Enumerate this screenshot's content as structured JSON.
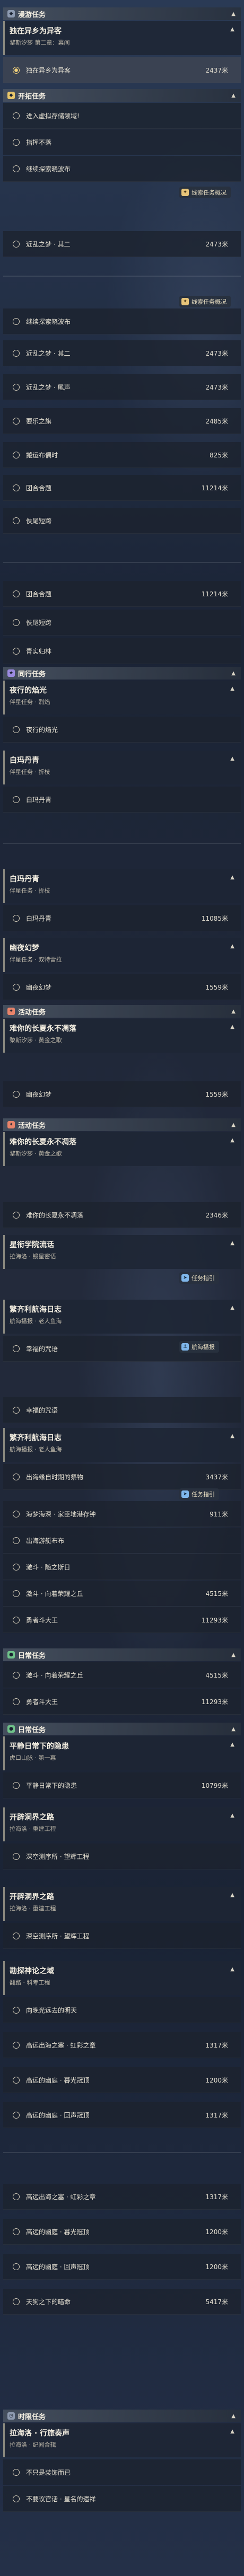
{
  "sections": {
    "exploration": {
      "label": "漫游任务"
    },
    "trailblaze": {
      "label": "开拓任务"
    },
    "companion": {
      "label": "同行任务"
    },
    "event": {
      "label": "活动任务"
    },
    "daily": {
      "label": "日常任务"
    },
    "time": {
      "label": "时限任务"
    }
  },
  "badges": {
    "trail": "线索任务概况",
    "guide": "任务指引",
    "flight": "航海播报"
  },
  "quests": {
    "q1": {
      "title": "独在异乡为异客",
      "sub": "黎斯汐莎 第二章：幕间"
    },
    "c1": {
      "title": "夜行的焰光",
      "sub": "伴星任务 · 烈焰"
    },
    "c2": {
      "title": "白玛丹青",
      "sub": "伴星任务 · 折枝"
    },
    "c3": {
      "title": "白玛丹青",
      "sub": "伴星任务 · 折枝"
    },
    "c4": {
      "title": "幽夜幻梦",
      "sub": "伴星任务 · 双特雷拉"
    },
    "e1": {
      "title": "难你的长夏永不凋落",
      "sub": "黎斯汐莎 · 黄金之歌"
    },
    "e2": {
      "title": "难你的长夏永不凋落",
      "sub": "黎斯汐莎 · 黄金之歌"
    },
    "e3": {
      "title": "星衔学院流话",
      "sub": "拉海洛 · 镜星密语"
    },
    "e4": {
      "title": "繁齐利航海日志",
      "sub": "航海播报 · 老人鱼海"
    },
    "e5": {
      "title": "繁齐利航海日志",
      "sub": "航海播报 · 老人鱼海"
    },
    "d1": {
      "title": "平静日常下的隐患",
      "sub": "虎口山脉 · 第一幕"
    },
    "d2": {
      "title": "开辟洞界之路",
      "sub": "拉海洛 · 重建工程"
    },
    "d3": {
      "title": "开辟洞界之路",
      "sub": "拉海洛 · 重建工程"
    },
    "d4": {
      "title": "勘探神论之域",
      "sub": "翻路 · 科考工程"
    },
    "t1": {
      "title": "拉海洛 · 行旅奏声",
      "sub": "拉海洛 · 纪闻合辑"
    }
  },
  "tasks": {
    "a1": {
      "name": "独在异乡为异客",
      "dist": "2437米"
    },
    "b1": {
      "name": "进入虚拟存储领域!"
    },
    "b2": {
      "name": "指挥不落"
    },
    "b3": {
      "name": "继续探索晓波布"
    },
    "b4": {
      "name": "近乱之梦 · 其二",
      "dist": "2473米"
    },
    "b5": {
      "name": "继续探索晓波布"
    },
    "b6": {
      "name": "近乱之梦 · 其二",
      "dist": "2473米"
    },
    "b7": {
      "name": "近乱之梦 · 尾声",
      "dist": "2473米"
    },
    "b8": {
      "name": "要乐之旗",
      "dist": "2485米"
    },
    "b9": {
      "name": "搬运布偶时",
      "dist": "825米"
    },
    "b10": {
      "name": "团合合题",
      "dist": "11214米"
    },
    "b11": {
      "name": "佚尾短跨"
    },
    "b12": {
      "name": "团合合题",
      "dist": "11214米"
    },
    "b13": {
      "name": "佚尾短跨"
    },
    "b14": {
      "name": "青实归林"
    },
    "c1a": {
      "name": "夜行的焰光"
    },
    "c2a": {
      "name": "白玛丹青"
    },
    "c3a": {
      "name": "白玛丹青",
      "dist": "11085米"
    },
    "c4a": {
      "name": "幽夜幻梦",
      "dist": "1559米"
    },
    "e1a": {
      "name": "幽夜幻梦",
      "dist": "1559米"
    },
    "e2a": {
      "name": "难你的长夏永不凋落",
      "dist": "2346米"
    },
    "e3a": {
      "name": "幸福的咒语"
    },
    "e4a": {
      "name": "幸福的咒语"
    },
    "e5a": {
      "name": "出海缘自时期的祭物",
      "dist": "3437米"
    },
    "e5b": {
      "name": "海梦海深 · 家臣地港存钟",
      "dist": "911米"
    },
    "e5c": {
      "name": "出海游艇布布"
    },
    "e5d": {
      "name": "激斗 · 随之斯日"
    },
    "e5e": {
      "name": "激斗 · 向着荣耀之丘",
      "dist": "4515米"
    },
    "e5f": {
      "name": "勇者斗大王",
      "dist": "11293米"
    },
    "e5g": {
      "name": "激斗 · 向着荣耀之丘",
      "dist": "4515米"
    },
    "e5h": {
      "name": "勇者斗大王",
      "dist": "11293米"
    },
    "d1a": {
      "name": "平静日常下的隐患",
      "dist": "10799米"
    },
    "d2a": {
      "name": "深空测序所 · 望辉工程"
    },
    "d3a": {
      "name": "深空测序所 · 望辉工程"
    },
    "d4a": {
      "name": "向晚光远去的明天"
    },
    "d4b": {
      "name": "高远出海之塞 · 虹彩之章",
      "dist": "1317米"
    },
    "d4c": {
      "name": "高远的幽庭 · 暮光冠顶",
      "dist": "1200米"
    },
    "d4d": {
      "name": "高远的幽庭 · 回声冠顶",
      "dist": "1317米"
    },
    "d4e": {
      "name": "高远出海之塞 · 虹彩之章",
      "dist": "1317米"
    },
    "d4f": {
      "name": "高远的幽庭 · 暮光冠顶",
      "dist": "1200米"
    },
    "d4g": {
      "name": "高远的幽庭 · 回声冠顶",
      "dist": "1200米"
    },
    "d4h": {
      "name": "天狗之下的暗命",
      "dist": "5417米"
    },
    "t1a": {
      "name": "不只是装饰而已"
    },
    "t1b": {
      "name": "不要议官话 · 星名的遗祥"
    }
  }
}
